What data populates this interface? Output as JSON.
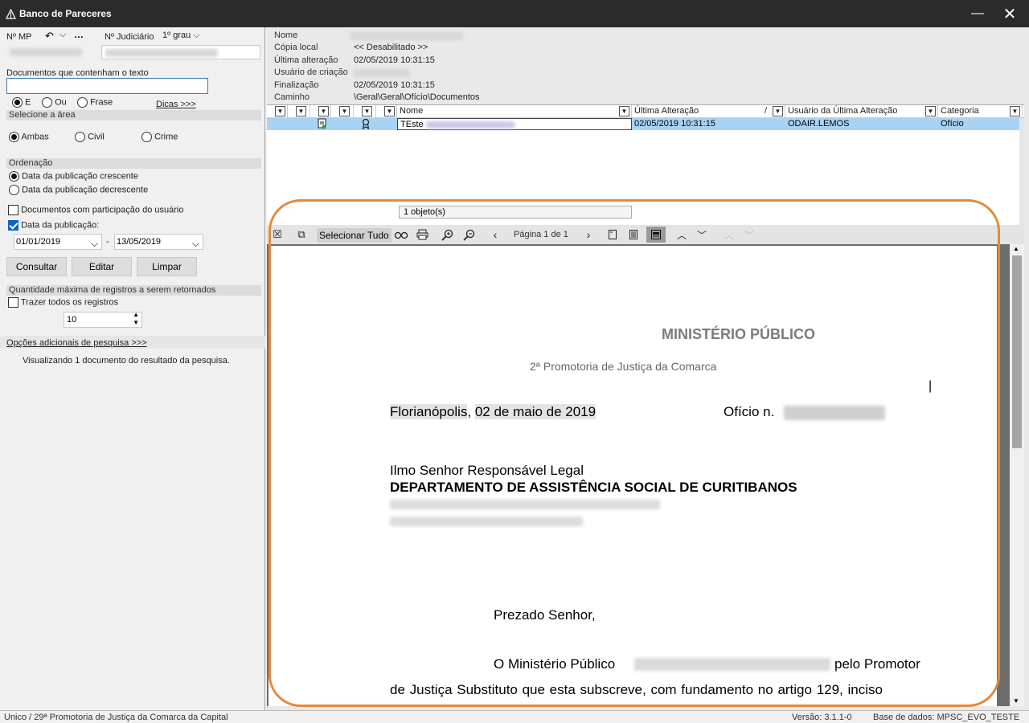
{
  "window": {
    "title": "Banco de Pareceres"
  },
  "search": {
    "nmp_label": "Nº MP",
    "judicial_label": "Nº Judiciário",
    "grau_value": "1º grau",
    "text_label": "Documentos que contenham o texto",
    "text_value": "",
    "mode_options": [
      "E",
      "Ou",
      "Frase"
    ],
    "mode_selected": "E",
    "tips_link": "Dicas >>>",
    "area_header": "Selecione a área",
    "area_options": [
      "Ambas",
      "Civil",
      "Crime"
    ],
    "area_selected": "Ambas",
    "order_header": "Ordenação",
    "order_options": [
      "Data da publicação crescente",
      "Data da publicação decrescente"
    ],
    "order_selected": "Data da publicação crescente",
    "participation_label": "Documentos com participação do usuário",
    "participation_checked": false,
    "pubdate_label": "Data da publicação:",
    "pubdate_checked": true,
    "date_from": "01/01/2019",
    "date_to": "13/05/2019",
    "buttons": {
      "search": "Consultar",
      "edit": "Editar",
      "clear": "Limpar"
    },
    "max_header": "Quantidade máxima de registros a serem retornados",
    "all_records_label": "Trazer todos os registros",
    "all_records_checked": false,
    "max_value": "10",
    "extra_options_link": "Opções adicionais de pesquisa >>>",
    "result_text": "Visualizando 1 documento do resultado da pesquisa."
  },
  "details": {
    "nome_label": "Nome",
    "copia_label": "Cópia local",
    "copia_value": "<< Desabilitado >>",
    "ultima_label": "Última alteração",
    "ultima_value": "02/05/2019 10:31:15",
    "usuario_label": "Usuário de criação",
    "final_label": "Finalização",
    "final_value": "02/05/2019 10:31:15",
    "caminho_label": "Caminho",
    "caminho_value": "\\Geral\\Geral\\Ofício\\Documentos"
  },
  "grid": {
    "columns": [
      "Nome",
      "Última Alteração",
      "Usuário da Última Alteração",
      "Categoria"
    ],
    "rows": [
      {
        "nome": "TEste",
        "ultima": "02/05/2019 10:31:15",
        "usuario": "ODAIR.LEMOS",
        "categoria": "Ofício"
      }
    ],
    "status": "1 objeto(s)"
  },
  "viewer": {
    "select_all": "Selecionar Tudo",
    "page_info": "Página 1 de 1"
  },
  "document": {
    "heading": "MINISTÉRIO PÚBLICO",
    "subheading": "2ª Promotoria de Justiça da Comarca",
    "city": "Florianópolis",
    "date": "02 de maio de 2019",
    "oficio_label": "Ofício n.",
    "addressee": "Ilmo Senhor Responsável Legal",
    "department": "DEPARTAMENTO DE ASSISTÊNCIA SOCIAL DE CURITIBANOS",
    "greeting": "Prezado Senhor,",
    "para1_start": "O Ministério Público",
    "para1_end": "pelo Promotor",
    "para1_line2": "de Justiça Substituto que esta subscreve, com fundamento no artigo 129, inciso"
  },
  "statusbar": {
    "left": "Unico / 29ª Promotoria de Justiça da Comarca da Capital",
    "version": "Versão: 3.1.1-0",
    "database": "Base de dados: MPSC_EVO_TESTE"
  },
  "colors": {
    "selection": "#a9d3f5",
    "annotation": "#e18a3b",
    "accent": "#0a64c8"
  }
}
